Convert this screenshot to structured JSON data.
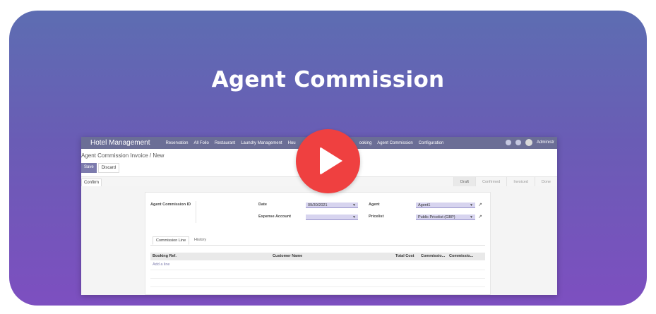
{
  "banner": {
    "title": "Agent Commission"
  },
  "app": {
    "brand": "Hotel Management",
    "menu": [
      "Reservation",
      "All Folio",
      "Restaurant",
      "Laundry Management",
      "Hou",
      "ooking",
      "Agent Commission",
      "Configuration"
    ],
    "user": "Administr"
  },
  "breadcrumb": "Agent Commission Invoice / New",
  "actions": {
    "save": "Save",
    "discard": "Discard",
    "confirm": "Confirm"
  },
  "stages": [
    "Draft",
    "Confirmed",
    "Invoiced",
    "Done"
  ],
  "form": {
    "commission_id_label": "Agent Commission ID",
    "date_label": "Date",
    "date_value": "09/30/2021",
    "expense_label": "Expense Account",
    "expense_value": "",
    "agent_label": "Agent",
    "agent_value": "Agent1",
    "pricelist_label": "Pricelist",
    "pricelist_value": "Public Pricelist (GBP)"
  },
  "tabs": [
    "Commission Line",
    "History"
  ],
  "table": {
    "columns": [
      "Booking Ref.",
      "Customer Name",
      "Total Cost",
      "Commissio...",
      "Commissio..."
    ],
    "add_line": "Add a line"
  },
  "colors": {
    "navbar": "#6b6e96",
    "play": "#ef4040",
    "accent": "#7c7bad"
  }
}
